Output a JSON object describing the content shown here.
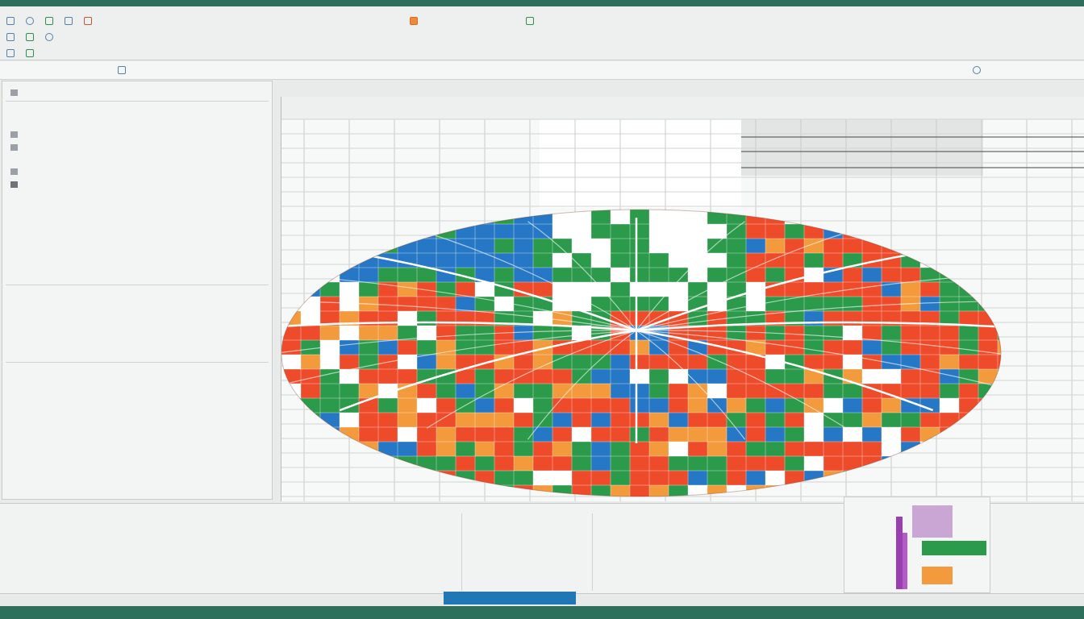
{
  "colors": {
    "chrome": "#2d6f5a",
    "accent_blue": "#1f78b4",
    "chart_red": "#ee4b2b",
    "chart_green": "#2b9a4a",
    "chart_blue": "#2678c6",
    "chart_orange": "#f39a3c",
    "chart_purple": "#9a3fb0"
  },
  "ribbon": {
    "icons": [
      "file-icon",
      "save-icon",
      "undo-icon",
      "paint-icon",
      "table-icon",
      "chart-icon",
      "filter-icon",
      "settings-icon"
    ]
  },
  "active_tab": {
    "label": ""
  }
}
